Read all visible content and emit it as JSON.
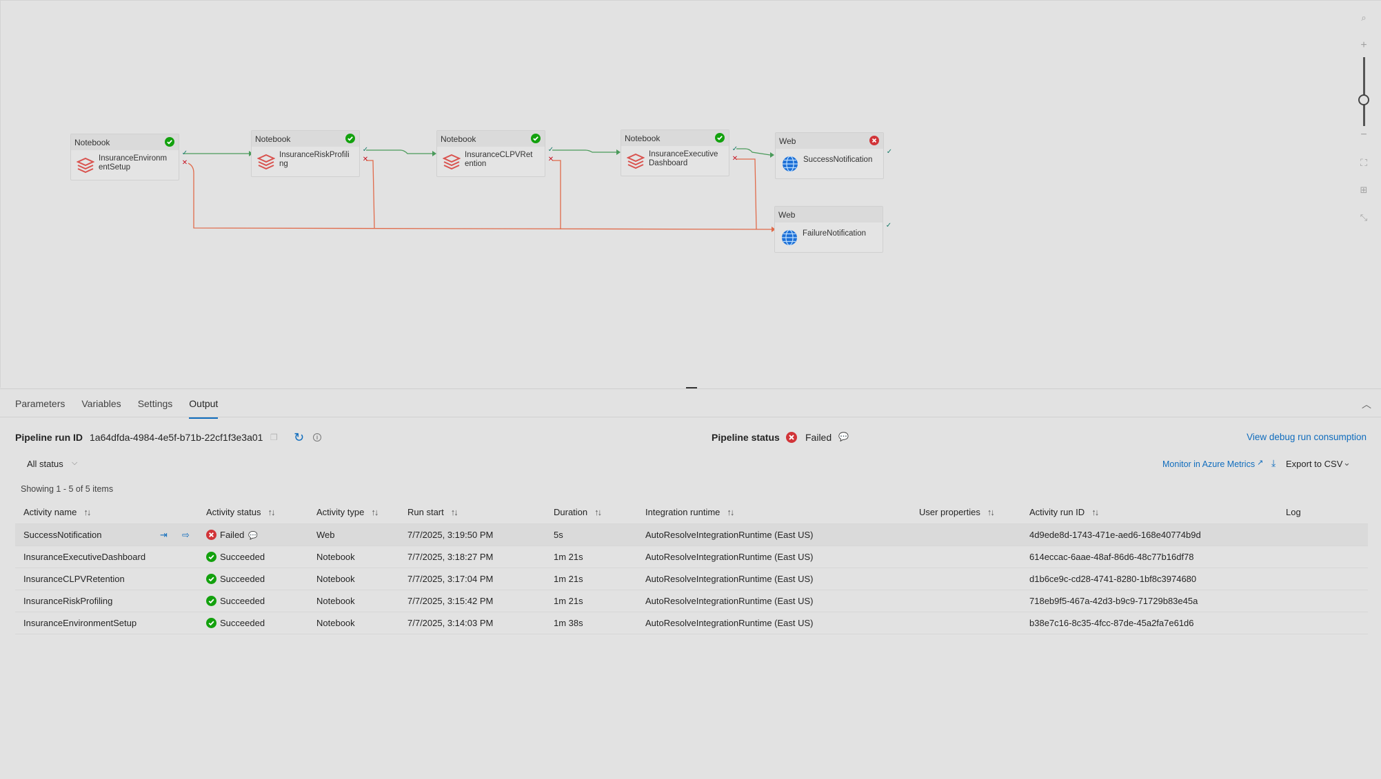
{
  "canvas": {
    "nodes": [
      {
        "type": "Notebook",
        "name": "InsuranceEnvironmentSetup",
        "status": "succeeded"
      },
      {
        "type": "Notebook",
        "name": "InsuranceRiskProfiling",
        "status": "succeeded"
      },
      {
        "type": "Notebook",
        "name": "InsuranceCLPVRetention",
        "status": "succeeded"
      },
      {
        "type": "Notebook",
        "name": "InsuranceExecutiveDashboard",
        "status": "succeeded"
      },
      {
        "type": "Web",
        "name": "SuccessNotification",
        "status": "failed"
      },
      {
        "type": "Web",
        "name": "FailureNotification",
        "status": "none"
      }
    ],
    "colors": {
      "success_edge": "#4a9a5a",
      "failure_edge": "#e06a4a",
      "notebook_icon": "#d9534f",
      "web_icon": "#1c6fd6"
    }
  },
  "tabs": [
    "Parameters",
    "Variables",
    "Settings",
    "Output"
  ],
  "active_tab": "Output",
  "run": {
    "label": "Pipeline run ID",
    "id": "1a64dfda-4984-4e5f-b71b-22cf1f3e3a01",
    "status_label": "Pipeline status",
    "status_value": "Failed",
    "debug_link": "View debug run consumption"
  },
  "filter": {
    "status": "All status",
    "azure_link": "Monitor in Azure Metrics",
    "export": "Export to CSV"
  },
  "showing": "Showing 1 - 5 of 5 items",
  "table": {
    "headers": [
      "Activity name",
      "Activity status",
      "Activity type",
      "Run start",
      "Duration",
      "Integration runtime",
      "User properties",
      "Activity run ID",
      "Log"
    ],
    "rows": [
      {
        "name": "SuccessNotification",
        "status": "Failed",
        "type": "Web",
        "start": "7/7/2025, 3:19:50 PM",
        "duration": "5s",
        "runtime": "AutoResolveIntegrationRuntime (East US)",
        "props": "",
        "run_id": "4d9ede8d-1743-471e-aed6-168e40774b9d"
      },
      {
        "name": "InsuranceExecutiveDashboard",
        "status": "Succeeded",
        "type": "Notebook",
        "start": "7/7/2025, 3:18:27 PM",
        "duration": "1m 21s",
        "runtime": "AutoResolveIntegrationRuntime (East US)",
        "props": "",
        "run_id": "614eccac-6aae-48af-86d6-48c77b16df78"
      },
      {
        "name": "InsuranceCLPVRetention",
        "status": "Succeeded",
        "type": "Notebook",
        "start": "7/7/2025, 3:17:04 PM",
        "duration": "1m 21s",
        "runtime": "AutoResolveIntegrationRuntime (East US)",
        "props": "",
        "run_id": "d1b6ce9c-cd28-4741-8280-1bf8c3974680"
      },
      {
        "name": "InsuranceRiskProfiling",
        "status": "Succeeded",
        "type": "Notebook",
        "start": "7/7/2025, 3:15:42 PM",
        "duration": "1m 21s",
        "runtime": "AutoResolveIntegrationRuntime (East US)",
        "props": "",
        "run_id": "718eb9f5-467a-42d3-b9c9-71729b83e45a"
      },
      {
        "name": "InsuranceEnvironmentSetup",
        "status": "Succeeded",
        "type": "Notebook",
        "start": "7/7/2025, 3:14:03 PM",
        "duration": "1m 38s",
        "runtime": "AutoResolveIntegrationRuntime (East US)",
        "props": "",
        "run_id": "b38e7c16-8c35-4fcc-87de-45a2fa7e61d6"
      }
    ]
  }
}
